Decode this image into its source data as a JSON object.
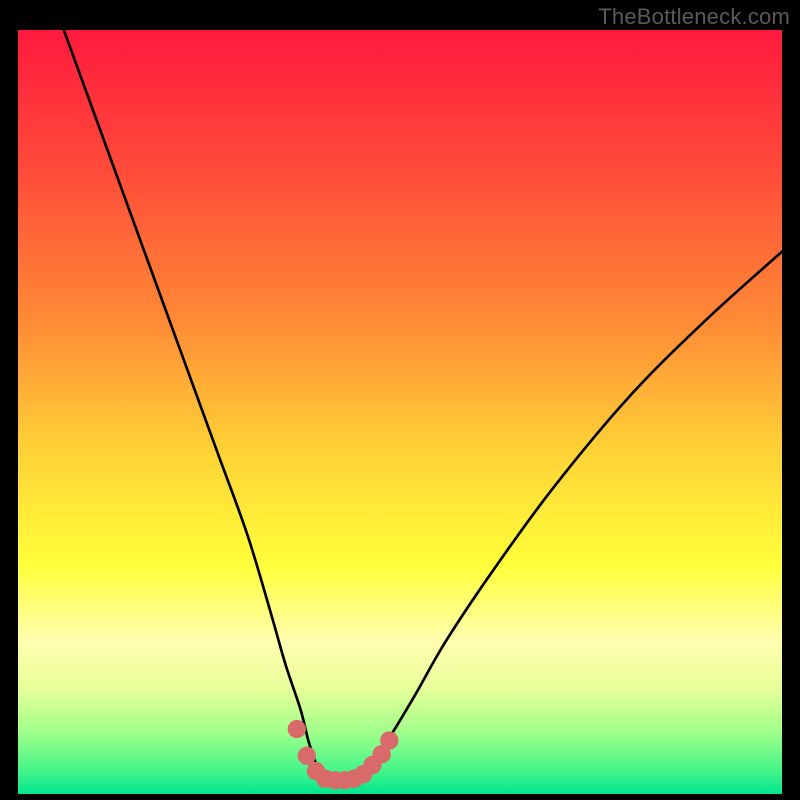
{
  "watermark": "TheBottleneck.com",
  "chart_data": {
    "type": "line",
    "title": "",
    "xlabel": "",
    "ylabel": "",
    "xlim": [
      0,
      100
    ],
    "ylim": [
      0,
      100
    ],
    "grid": false,
    "gradient_stops": [
      {
        "offset": 0,
        "color": "#ff1a3d"
      },
      {
        "offset": 18,
        "color": "#ff4a3a"
      },
      {
        "offset": 38,
        "color": "#ff8a36"
      },
      {
        "offset": 55,
        "color": "#ffd236"
      },
      {
        "offset": 70,
        "color": "#ffff3a"
      },
      {
        "offset": 80,
        "color": "#ffffb0"
      },
      {
        "offset": 86,
        "color": "#e9ff9a"
      },
      {
        "offset": 92,
        "color": "#9fff8a"
      },
      {
        "offset": 97,
        "color": "#43f58a"
      },
      {
        "offset": 100,
        "color": "#00e58d"
      }
    ],
    "series": [
      {
        "name": "bottleneck-curve",
        "color": "#000000",
        "x": [
          6,
          10,
          14,
          18,
          22,
          26,
          30,
          33,
          35,
          37,
          38,
          39,
          40,
          41,
          43,
          45,
          47,
          49,
          52,
          56,
          62,
          70,
          80,
          90,
          100
        ],
        "y": [
          100,
          89,
          78,
          67,
          56,
          45,
          34,
          24,
          17,
          11,
          7,
          4,
          2,
          2,
          2,
          3,
          5,
          8,
          13,
          20,
          29,
          40,
          52,
          62,
          71
        ]
      }
    ],
    "markers": {
      "name": "trough-markers",
      "color": "#d96a6a",
      "radius": 1.2,
      "points": [
        {
          "x": 36.5,
          "y": 8.5
        },
        {
          "x": 37.8,
          "y": 5.0
        },
        {
          "x": 39.0,
          "y": 3.0
        },
        {
          "x": 40.2,
          "y": 2.0
        },
        {
          "x": 41.5,
          "y": 1.8
        },
        {
          "x": 42.8,
          "y": 1.8
        },
        {
          "x": 44.0,
          "y": 2.0
        },
        {
          "x": 45.2,
          "y": 2.6
        },
        {
          "x": 46.4,
          "y": 3.8
        },
        {
          "x": 47.6,
          "y": 5.2
        },
        {
          "x": 48.6,
          "y": 7.0
        }
      ]
    }
  }
}
